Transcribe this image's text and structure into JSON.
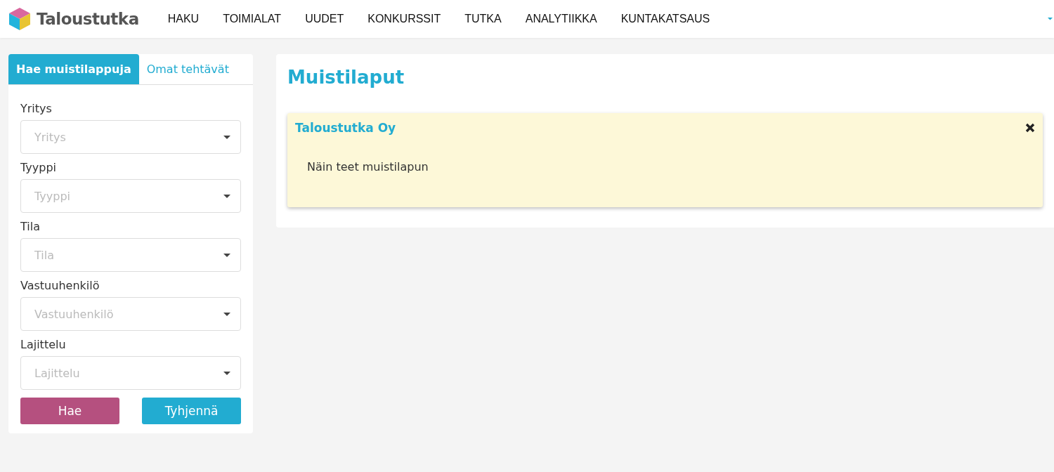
{
  "header": {
    "logo": "Taloustutka",
    "nav": [
      "HAKU",
      "TOIMIALAT",
      "UUDET",
      "KONKURSSIT",
      "TUTKA",
      "ANALYTIIKKA",
      "KUNTAKATSAUS"
    ]
  },
  "sidebar": {
    "tabs": [
      {
        "label": "Hae muistilappuja",
        "selected": true
      },
      {
        "label": "Omat tehtävät",
        "selected": false
      }
    ],
    "fields": [
      {
        "label": "Yritys",
        "placeholder": "Yritys"
      },
      {
        "label": "Tyyppi",
        "placeholder": "Tyyppi"
      },
      {
        "label": "Tila",
        "placeholder": "Tila"
      },
      {
        "label": "Vastuuhenkilö",
        "placeholder": "Vastuuhenkilö"
      },
      {
        "label": "Lajittelu",
        "placeholder": "Lajittelu"
      }
    ],
    "buttons": [
      {
        "label": "Hae",
        "kind": "primary"
      },
      {
        "label": "Tyhjennä",
        "kind": "secondary"
      }
    ]
  },
  "main": {
    "title": "Muistilaput",
    "notes": [
      {
        "company": "Taloustutka Oy",
        "text": "Näin teet muistilapun"
      }
    ]
  }
}
